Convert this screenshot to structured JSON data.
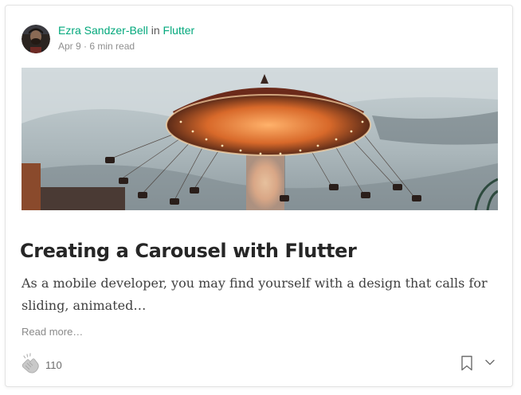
{
  "post": {
    "author": "Ezra Sandzer-Bell",
    "in_word": "in",
    "publication": "Flutter",
    "date": "Apr 9",
    "separator": "·",
    "read_time": "6 min read",
    "title": "Creating a Carousel with Flutter",
    "subtitle": "As a mobile developer, you may find yourself with a design that calls for sliding, animated…",
    "read_more": "Read more…",
    "claps": "110"
  },
  "colors": {
    "accent": "#03a87c",
    "title": "#262626",
    "body": "#404040",
    "muted": "#8f8f8f"
  },
  "icons": {
    "clap": "clap-icon",
    "bookmark": "bookmark-icon",
    "more": "chevron-down-icon"
  }
}
